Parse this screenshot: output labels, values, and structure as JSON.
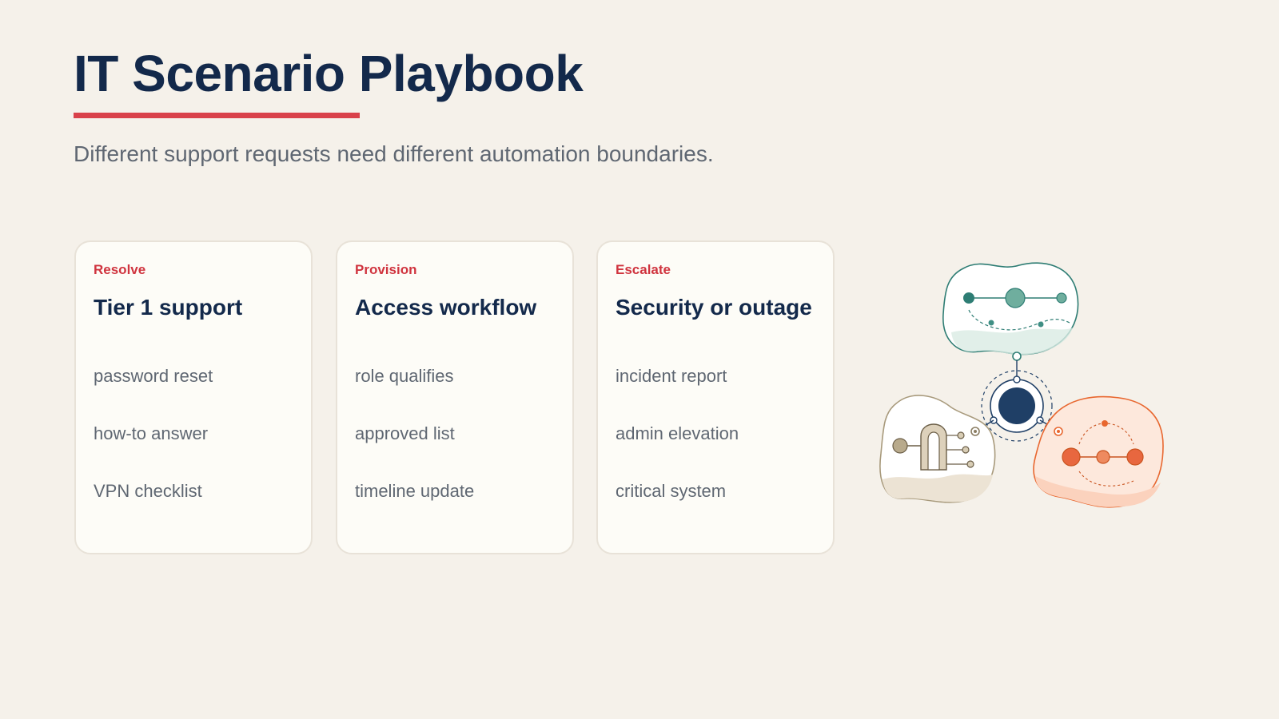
{
  "header": {
    "title": "IT Scenario Playbook",
    "subtitle": "Different support requests need different automation boundaries."
  },
  "cards": [
    {
      "kicker": "Resolve",
      "title": "Tier 1 support",
      "items": [
        "password reset",
        "how-to answer",
        "VPN checklist"
      ]
    },
    {
      "kicker": "Provision",
      "title": "Access workflow",
      "items": [
        "role qualifies",
        "approved list",
        "timeline update"
      ]
    },
    {
      "kicker": "Escalate",
      "title": "Security or outage",
      "items": [
        "incident report",
        "admin elevation",
        "critical system"
      ]
    }
  ],
  "colors": {
    "background": "#f5f1ea",
    "title": "#13294b",
    "accent": "#d9414a",
    "muted": "#5f6772",
    "teal": "#2e7d74",
    "orange": "#e8672f",
    "beige": "#a89a7c",
    "navy": "#1f3f66"
  },
  "illustration": {
    "icon": "network-hub-illustration"
  }
}
